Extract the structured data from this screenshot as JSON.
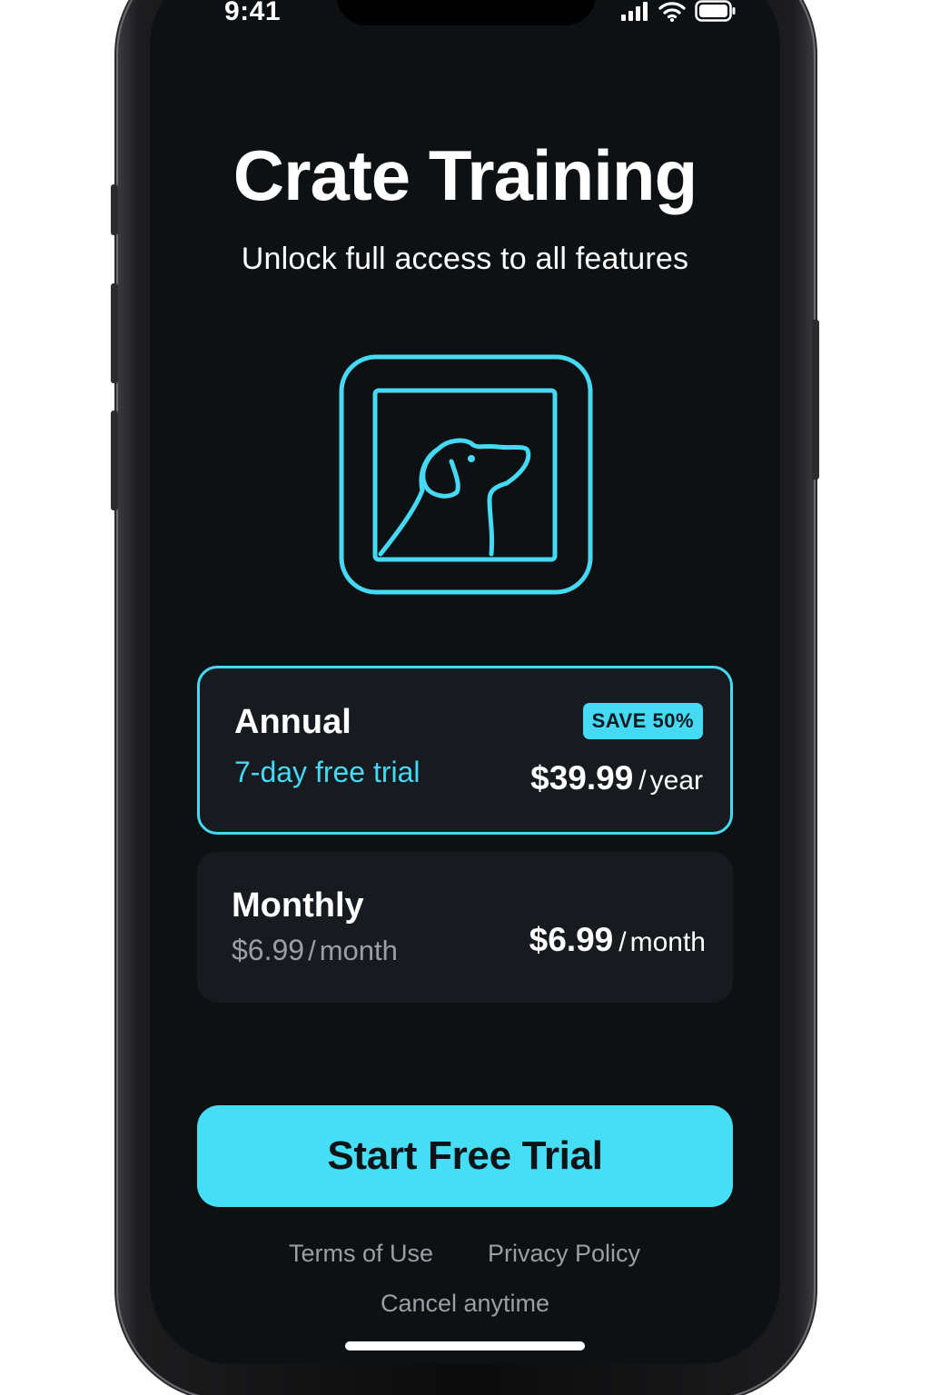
{
  "status_bar": {
    "time": "9:41",
    "icons": [
      "signal-icon",
      "wifi-icon",
      "battery-icon"
    ]
  },
  "header": {
    "title": "Crate Training",
    "subtitle": "Unlock full access to all features"
  },
  "app_icon": {
    "icon": "dog-crate-icon",
    "color": "#45d9f4"
  },
  "plans": [
    {
      "name": "Annual",
      "subtitle": "7-day free trial",
      "badge": "SAVE 50%",
      "price": "$39.99",
      "separator": "/",
      "period": "year",
      "selected": true
    },
    {
      "name": "Monthly",
      "subtitle_price": "$6.99",
      "subtitle_separator": "/",
      "subtitle_period": "month",
      "price": "$6.99",
      "separator": "/",
      "period": "month",
      "selected": false
    }
  ],
  "cta": {
    "label": "Start Free Trial"
  },
  "footer": {
    "terms": "Terms of Use",
    "privacy": "Privacy Policy",
    "note": "Cancel anytime"
  },
  "colors": {
    "accent": "#45d9f4",
    "background": "#0e1114",
    "card": "#171b20",
    "muted_text": "#9a9fa6"
  }
}
